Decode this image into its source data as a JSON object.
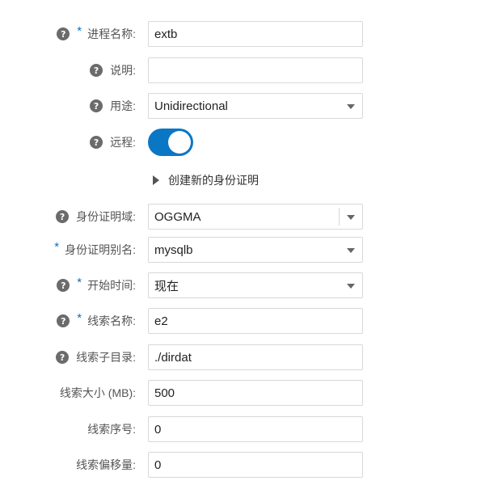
{
  "form": {
    "process_name": {
      "label": "进程名称:",
      "value": "extb"
    },
    "description": {
      "label": "说明:",
      "value": ""
    },
    "purpose": {
      "label": "用途:",
      "value": "Unidirectional"
    },
    "remote": {
      "label": "远程:",
      "on": true
    },
    "create_credential": {
      "label": "创建新的身份证明"
    },
    "credential_domain": {
      "label": "身份证明域:",
      "value": "OGGMA"
    },
    "credential_alias": {
      "label": "身份证明别名:",
      "value": "mysqlb"
    },
    "start_time": {
      "label": "开始时间:",
      "value": "现在"
    },
    "trail_name": {
      "label": "线索名称:",
      "value": "e2"
    },
    "trail_subdir": {
      "label": "线索子目录:",
      "value": "./dirdat"
    },
    "trail_size": {
      "label": "线索大小 (MB):",
      "value": "500"
    },
    "trail_seq": {
      "label": "线索序号:",
      "value": "0"
    },
    "trail_offset": {
      "label": "线索偏移量:",
      "value": "0"
    }
  },
  "icons": {
    "help": "help-icon",
    "required": "*"
  },
  "colors": {
    "accent": "#0a77c5",
    "required": "#0a6fc2",
    "help_icon": "#6b6b6b"
  }
}
